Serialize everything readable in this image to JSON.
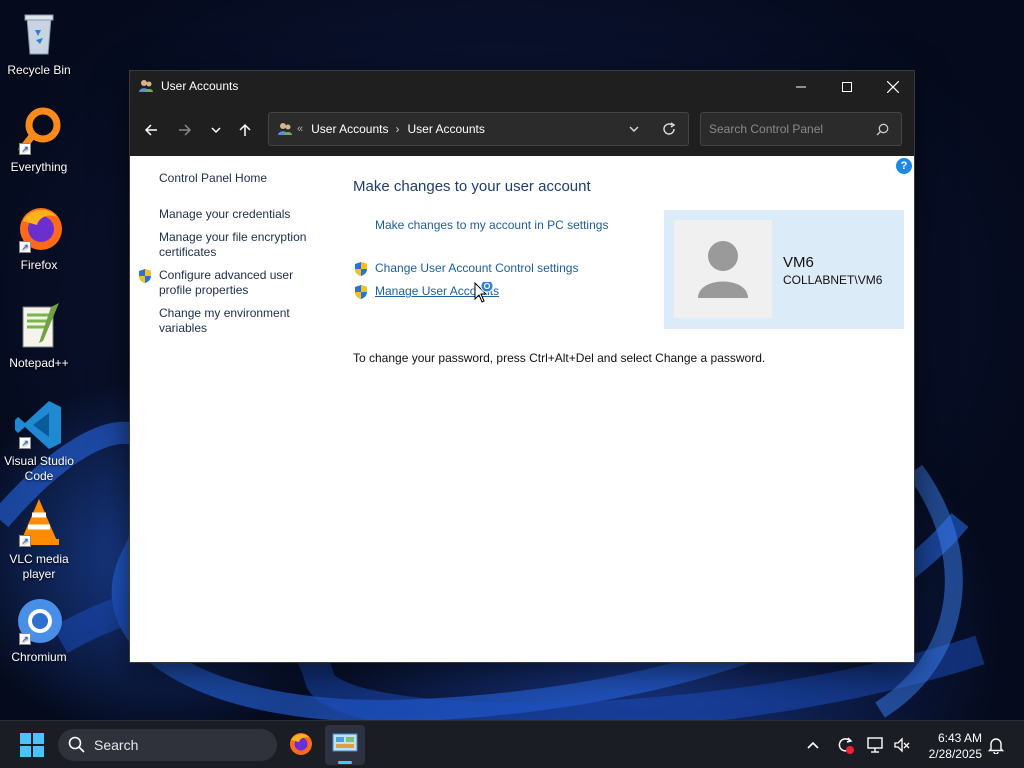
{
  "desktop": {
    "icons": [
      {
        "label": "Recycle Bin",
        "icon": "recycle-bin-icon"
      },
      {
        "label": "Everything",
        "icon": "everything-icon"
      },
      {
        "label": "Firefox",
        "icon": "firefox-icon"
      },
      {
        "label": "Notepad++",
        "icon": "notepadpp-icon"
      },
      {
        "label": "Visual Studio Code",
        "icon": "vscode-icon"
      },
      {
        "label": "VLC media player",
        "icon": "vlc-icon"
      },
      {
        "label": "Chromium",
        "icon": "chromium-icon"
      }
    ]
  },
  "window": {
    "title": "User Accounts",
    "address": {
      "prefix": "«",
      "crumbs": [
        "User Accounts",
        "User Accounts"
      ]
    },
    "search_placeholder": "Search Control Panel",
    "left_nav": {
      "home": "Control Panel Home",
      "links": [
        "Manage your credentials",
        "Manage your file encryption certificates",
        "Configure advanced user profile properties",
        "Change my environment variables"
      ]
    },
    "main": {
      "title": "Make changes to your user account",
      "link_pc_settings": "Make changes to my account in PC settings",
      "link_uac": "Change User Account Control settings",
      "link_manage": "Manage User Accounts",
      "password_note": "To change your password, press Ctrl+Alt+Del and select Change a password."
    },
    "user": {
      "name": "VM6",
      "domain": "COLLABNET\\VM6"
    },
    "help_label": "?"
  },
  "taskbar": {
    "search_label": "Search",
    "time": "6:43 AM",
    "date": "2/28/2025"
  },
  "colors": {
    "link": "#1a5e9e",
    "title": "#1e3d73",
    "titlebar": "#1f1f1f",
    "user_panel": "#dcebf8"
  }
}
